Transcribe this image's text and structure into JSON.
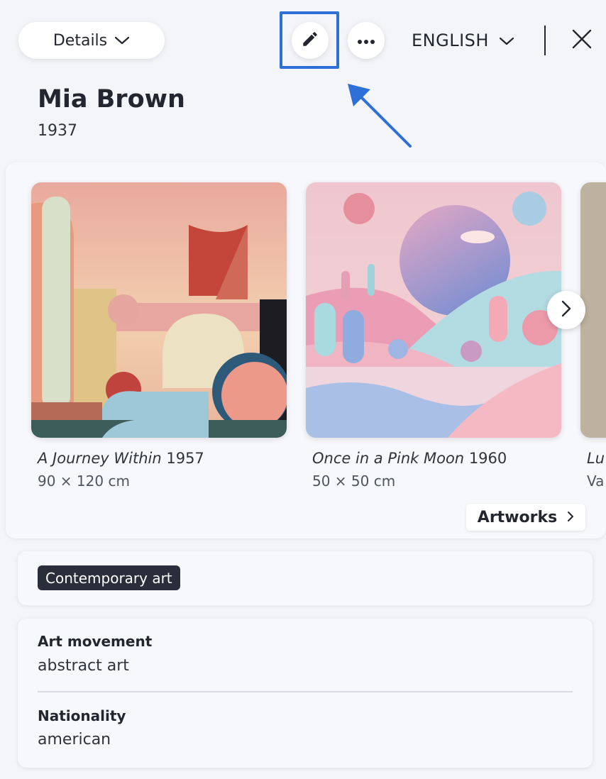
{
  "header": {
    "details_label": "Details",
    "language_label": "ENGLISH"
  },
  "artist": {
    "name": "Mia Brown",
    "year": "1937"
  },
  "artworks": [
    {
      "title": "A Journey Within",
      "year": "1957",
      "dimensions": "90 × 120 cm"
    },
    {
      "title": "Once in a Pink Moon",
      "year": "1960",
      "dimensions": "50 × 50 cm"
    },
    {
      "title": "Lu",
      "year": "",
      "dimensions": "Va"
    }
  ],
  "carousel": {
    "artworks_link_label": "Artworks"
  },
  "tags": [
    "Contemporary art"
  ],
  "info": {
    "movement_label": "Art movement",
    "movement_value": "abstract art",
    "nationality_label": "Nationality",
    "nationality_value": "american"
  },
  "colors": {
    "highlight": "#2f6fd8",
    "tag_bg": "#2a2e3a",
    "background": "#f4f5f9"
  },
  "icons": [
    "chevron-down-icon",
    "pencil-icon",
    "more-horizontal-icon",
    "close-icon",
    "chevron-right-icon"
  ]
}
